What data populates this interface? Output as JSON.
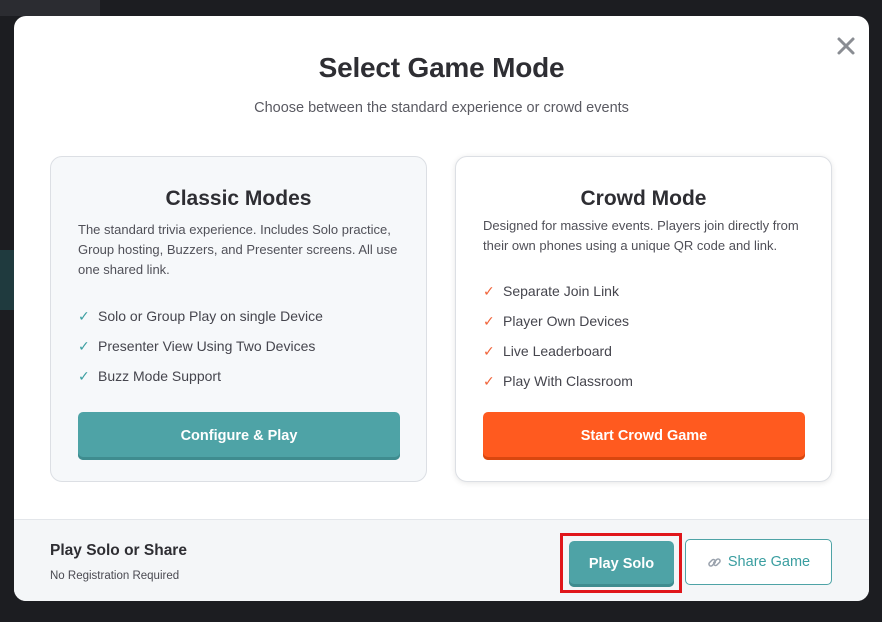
{
  "modal": {
    "title": "Select Game Mode",
    "subtitle": "Choose between the standard experience or crowd events",
    "close_icon": "close-icon"
  },
  "classic": {
    "title": "Classic Modes",
    "description": "The standard trivia experience. Includes Solo practice, Group hosting, Buzzers, and Presenter screens. All use one shared link.",
    "features": [
      "Solo or Group Play on single Device",
      "Presenter View Using Two Devices",
      "Buzz Mode Support"
    ],
    "button_label": "Configure & Play",
    "check_icon": "check-icon"
  },
  "crowd": {
    "title": "Crowd Mode",
    "description": "Designed for massive events. Players join directly from their own phones using a unique QR code and link.",
    "features": [
      "Separate Join Link",
      "Player Own Devices",
      "Live Leaderboard",
      "Play With Classroom"
    ],
    "button_label": "Start Crowd Game",
    "check_icon": "check-icon"
  },
  "footer": {
    "title": "Play Solo or Share",
    "subtitle": "No Registration Required",
    "play_solo_label": "Play Solo",
    "share_label": "Share Game",
    "share_icon": "link-icon"
  },
  "colors": {
    "teal": "#4ea3a6",
    "orange": "#ff5a1f",
    "highlight": "#e0161b"
  }
}
